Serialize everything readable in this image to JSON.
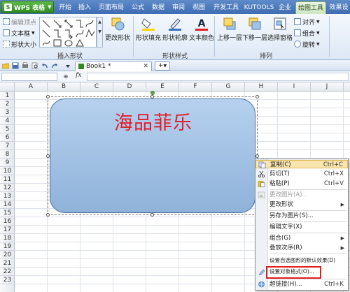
{
  "app": {
    "logo_label": "WPS 表格",
    "tabs": [
      "开始",
      "插入",
      "页面布局",
      "公式",
      "数据",
      "审阅",
      "视图",
      "开发工具",
      "KUTOOLS",
      "企业",
      "绘图工具",
      "效果设"
    ]
  },
  "ribbon": {
    "insert_shape": {
      "edit_vertex": "编辑顶点",
      "textbox": "文本框",
      "shape_size": "形状大小",
      "change_shape": "更改形状",
      "group_label": "插入形状"
    },
    "shape_style": {
      "fill": "形状填充",
      "outline": "形状轮廓",
      "text_color": "文本颜色",
      "group_label": "形状样式"
    },
    "arrange": {
      "bring_forward": "上移一层",
      "send_backward": "下移一层",
      "selection_pane": "选择窗格",
      "align": "对齐",
      "group": "组合",
      "rotate": "旋转",
      "group_label": "排列"
    }
  },
  "doc": {
    "tab_name": "Book1 *",
    "add_tab": "+"
  },
  "formula_bar": {
    "fx": "fx"
  },
  "sheet": {
    "columns": [
      "A",
      "B",
      "C",
      "D",
      "E",
      "F",
      "G",
      "H",
      "I",
      "J"
    ],
    "rows": [
      "1",
      "2",
      "3",
      "4",
      "5",
      "6",
      "7",
      "8",
      "9",
      "10",
      "11",
      "12",
      "13",
      "14",
      "15",
      "16",
      "17",
      "18",
      "19",
      "20",
      "21",
      "22",
      "23"
    ]
  },
  "shape": {
    "text": "海品菲乐",
    "text_color": "#e0202a",
    "fill_color": "#a6c4e6"
  },
  "context_menu": {
    "items": [
      {
        "label": "复制(C)",
        "shortcut": "Ctrl+C",
        "highlight": true
      },
      {
        "label": "剪切(T)",
        "shortcut": "Ctrl+X"
      },
      {
        "label": "粘贴(P)",
        "shortcut": "Ctrl+V"
      },
      {
        "label": "更改图片(A)...",
        "disabled": true
      },
      {
        "label": "更改形状",
        "submenu": true
      },
      {
        "label": "另存为图片(S)..."
      },
      {
        "label": "编辑文字(X)"
      },
      {
        "label": "组合(G)",
        "submenu": true
      },
      {
        "label": "叠放次序(R)",
        "submenu": true
      },
      {
        "label": "设置自选图形的默认效果(D)"
      },
      {
        "label": "设置对象格式(O)..."
      },
      {
        "label": "超链接(H)...",
        "shortcut": "Ctrl+K"
      }
    ]
  }
}
